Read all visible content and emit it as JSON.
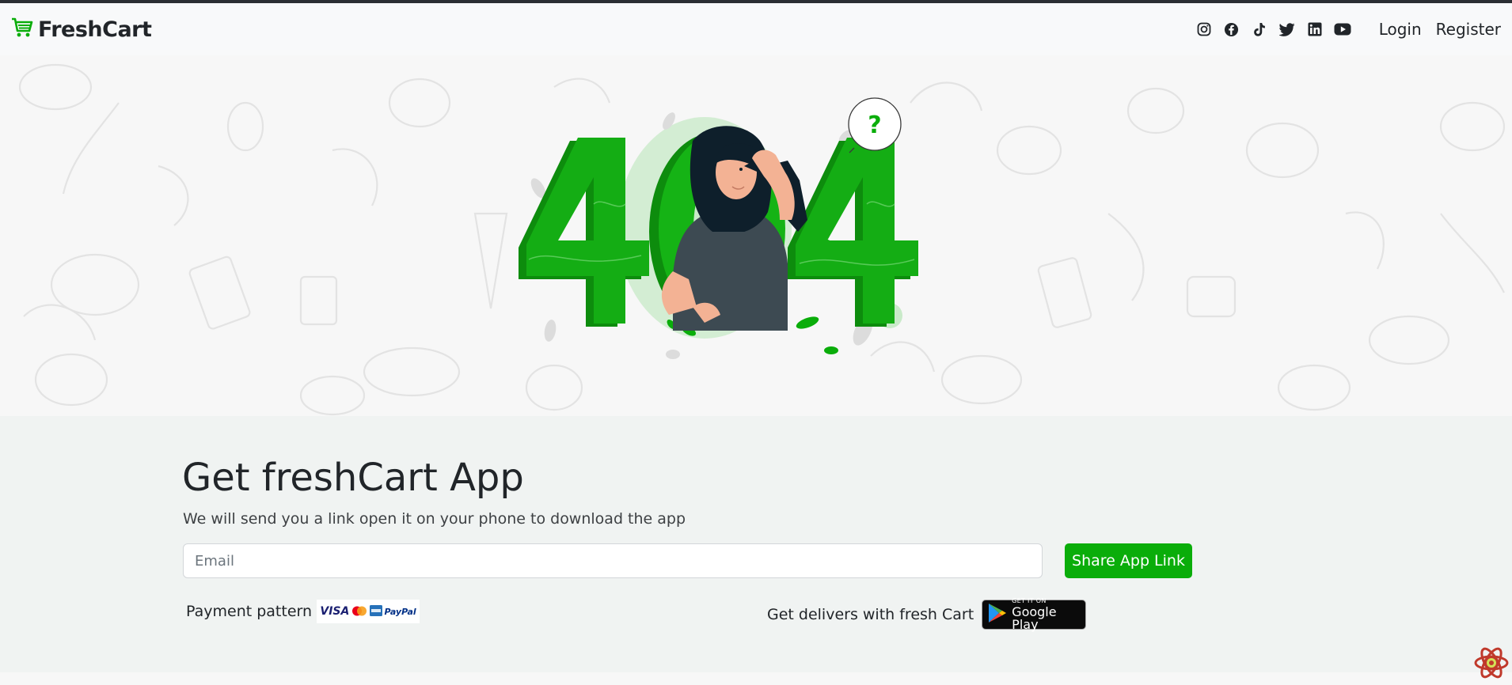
{
  "navbar": {
    "brand": "FreshCart",
    "social_icons": [
      "instagram-icon",
      "facebook-icon",
      "tiktok-icon",
      "twitter-icon",
      "linkedin-icon",
      "youtube-icon"
    ],
    "login": "Login",
    "register": "Register"
  },
  "hero": {
    "illustration": "404-illustration",
    "error_code": "404",
    "question_mark": "?"
  },
  "footer": {
    "title": "Get freshCart App",
    "subtitle": "We will send you a link open it on your phone to download the app",
    "email_placeholder": "Email",
    "share_button": "Share App Link",
    "payment_label": "Payment pattern",
    "payment_cards": [
      "VISA",
      "PayPal"
    ],
    "deliver_label": "Get delivers with fresh Cart",
    "google_play_small": "GET IT ON",
    "google_play_big": "Google Play"
  },
  "colors": {
    "brand_green": "#0aad0a",
    "footer_bg": "#f0f3f2",
    "navbar_bg": "#f8f9fa"
  }
}
